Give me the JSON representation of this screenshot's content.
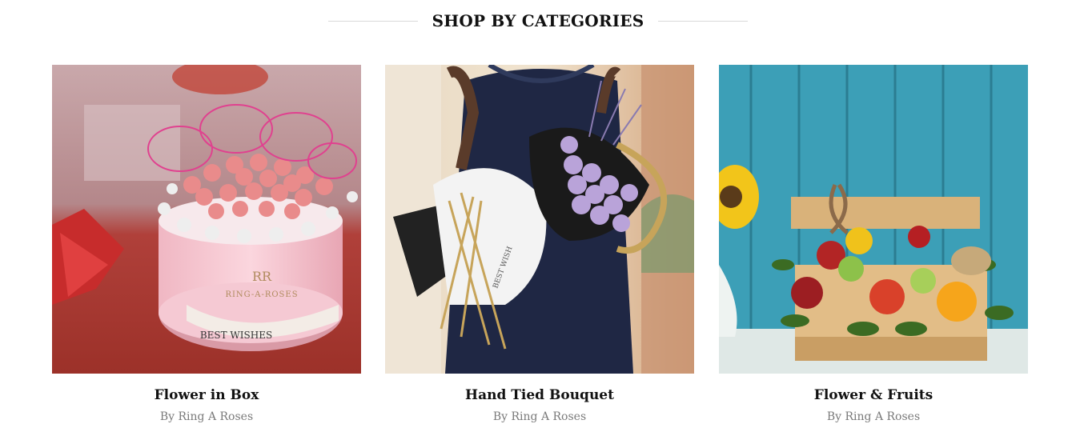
{
  "section": {
    "title": "SHOP BY CATEGORIES"
  },
  "categories": [
    {
      "name": "Flower in Box",
      "byline": "By Ring A Roses",
      "image": "pink roses in round pink hat box with baby's breath and gift bow",
      "box_text": "RING-A-ROSES",
      "ribbon_text": "BEST WISHES",
      "monogram": "RR"
    },
    {
      "name": "Hand Tied Bouquet",
      "byline": "By Ring A Roses",
      "image": "woman in navy dress holding lavender rose bouquet wrapped in black and white paper",
      "ribbon_text": "BEST WISH"
    },
    {
      "name": "Flower & Fruits",
      "byline": "By Ring A Roses",
      "image": "wooden chest with fruits and flowers in front of teal wooden wall"
    }
  ],
  "colors": {
    "heading": "#111111",
    "byline": "#7a7a7a",
    "divider": "#d9d9d9"
  }
}
